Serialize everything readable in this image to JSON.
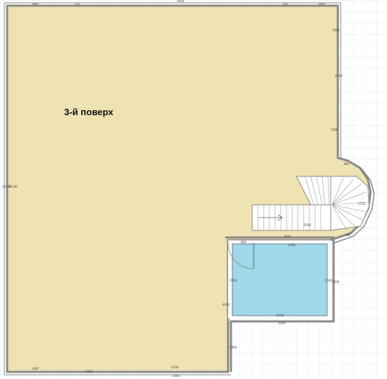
{
  "floor_label": "3-й поверх",
  "colors": {
    "floor": "#efe3b3",
    "pool": "#9ed8ea",
    "wall": "#8a8a8a",
    "grid": "#e8e8e8",
    "background": "#ffffff"
  },
  "dimensions": {
    "top_left": "1460",
    "top_left_2": "120",
    "top_mid": "3600",
    "top_right": "120",
    "top_right_2": "1460",
    "right_upper": "1080",
    "right_mid": "4440",
    "right_low": "1460",
    "left_side": "11930",
    "left_side_2": "11140",
    "stair_width": "1710",
    "stair_landing": "2200",
    "stair_arc_1": "380",
    "stair_arc_2": "380",
    "pool_top": "2820",
    "pool_top_2": "2440",
    "pool_door": "800",
    "pool_left": "2500",
    "pool_right": "2500",
    "pool_right_2": "2600",
    "pool_bottom": "2410",
    "pool_bottom_2": "3200",
    "pool_outer_left": "4000",
    "lower_left": "1960",
    "bottom_left": "1460",
    "bottom_mid": "2200",
    "bottom_right": "3100",
    "bottom_right_2": "3080"
  }
}
